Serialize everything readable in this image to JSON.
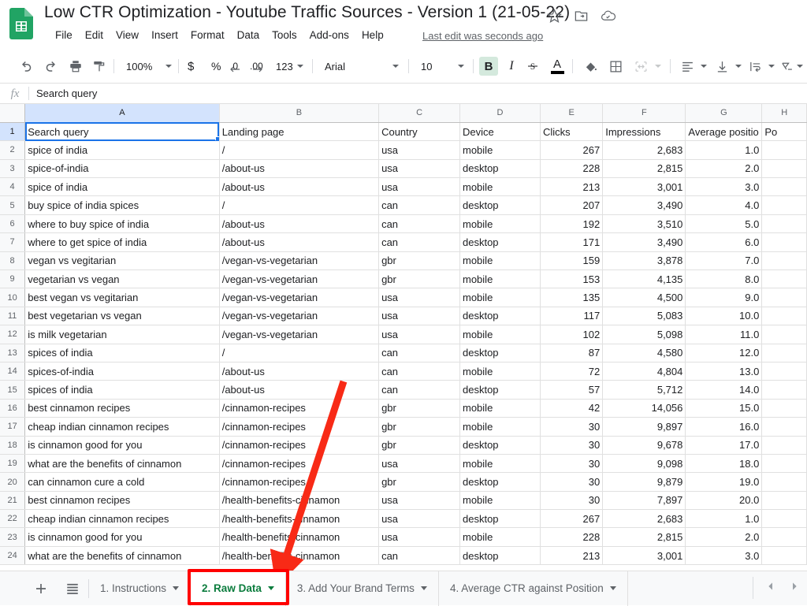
{
  "app": {
    "doc_title": "Low CTR Optimization - Youtube Traffic Sources - Version 1 (21-05-22)",
    "last_edit": "Last edit was seconds ago",
    "icons": {
      "app_logo": "sheets-logo-icon",
      "star": "star-icon",
      "move_to_folder": "move-to-folder-icon",
      "cloud": "cloud-saved-icon"
    }
  },
  "menubar": {
    "items": [
      "File",
      "Edit",
      "View",
      "Insert",
      "Format",
      "Data",
      "Tools",
      "Add-ons",
      "Help"
    ]
  },
  "toolbar": {
    "undo": "undo-icon",
    "redo": "redo-icon",
    "print": "print-icon",
    "paint_format": "paint-format-icon",
    "zoom_value": "100%",
    "currency": "$",
    "percent": "%",
    "decrease_decimal": ".0",
    "increase_decimal": ".00",
    "more_formats": "123",
    "font_name": "Arial",
    "font_size": "10",
    "bold": "B",
    "italic": "I",
    "strikethrough": "S",
    "text_color": "A",
    "fill_color": "fill-color-icon",
    "borders": "borders-icon",
    "merge_cells": "merge-cells-icon",
    "horizontal_align": "horizontal-align-icon",
    "vertical_align": "vertical-align-icon",
    "text_wrap": "text-wrap-icon",
    "text_rotation": "text-rotation-icon"
  },
  "formula_bar": {
    "fx_label": "fx",
    "value": "Search query"
  },
  "grid": {
    "column_letters": [
      "A",
      "B",
      "C",
      "D",
      "E",
      "F",
      "G",
      "H"
    ],
    "selected_cell": "A1",
    "headers": [
      "Search query",
      "Landing page",
      "Country",
      "Device",
      "Clicks",
      "Impressions",
      "Average positio",
      "Po"
    ],
    "rows": [
      {
        "n": "2",
        "a": "spice of india",
        "b": "/",
        "c": "usa",
        "d": "mobile",
        "e": "267",
        "f": "2,683",
        "g": "1.0"
      },
      {
        "n": "3",
        "a": "spice-of-india",
        "b": "/about-us",
        "c": "usa",
        "d": "desktop",
        "e": "228",
        "f": "2,815",
        "g": "2.0"
      },
      {
        "n": "4",
        "a": "spice of india",
        "b": "/about-us",
        "c": "usa",
        "d": "mobile",
        "e": "213",
        "f": "3,001",
        "g": "3.0"
      },
      {
        "n": "5",
        "a": "buy spice of india spices",
        "b": "/",
        "c": "can",
        "d": "desktop",
        "e": "207",
        "f": "3,490",
        "g": "4.0"
      },
      {
        "n": "6",
        "a": "where to buy spice of india",
        "b": "/about-us",
        "c": "can",
        "d": "mobile",
        "e": "192",
        "f": "3,510",
        "g": "5.0"
      },
      {
        "n": "7",
        "a": "where to get spice of india",
        "b": "/about-us",
        "c": "can",
        "d": "desktop",
        "e": "171",
        "f": "3,490",
        "g": "6.0"
      },
      {
        "n": "8",
        "a": "vegan vs vegitarian",
        "b": "/vegan-vs-vegetarian",
        "c": "gbr",
        "d": "mobile",
        "e": "159",
        "f": "3,878",
        "g": "7.0"
      },
      {
        "n": "9",
        "a": "vegetarian vs vegan",
        "b": "/vegan-vs-vegetarian",
        "c": "gbr",
        "d": "mobile",
        "e": "153",
        "f": "4,135",
        "g": "8.0"
      },
      {
        "n": "10",
        "a": "best vegan vs vegitarian",
        "b": "/vegan-vs-vegetarian",
        "c": "usa",
        "d": "mobile",
        "e": "135",
        "f": "4,500",
        "g": "9.0"
      },
      {
        "n": "11",
        "a": "best vegetarian vs vegan",
        "b": "/vegan-vs-vegetarian",
        "c": "usa",
        "d": "desktop",
        "e": "117",
        "f": "5,083",
        "g": "10.0"
      },
      {
        "n": "12",
        "a": "is milk vegetarian",
        "b": "/vegan-vs-vegetarian",
        "c": "usa",
        "d": "mobile",
        "e": "102",
        "f": "5,098",
        "g": "11.0"
      },
      {
        "n": "13",
        "a": "spices of india",
        "b": "/",
        "c": "can",
        "d": "desktop",
        "e": "87",
        "f": "4,580",
        "g": "12.0"
      },
      {
        "n": "14",
        "a": "spices-of-india",
        "b": "/about-us",
        "c": "can",
        "d": "mobile",
        "e": "72",
        "f": "4,804",
        "g": "13.0"
      },
      {
        "n": "15",
        "a": "spices of india",
        "b": "/about-us",
        "c": "can",
        "d": "desktop",
        "e": "57",
        "f": "5,712",
        "g": "14.0"
      },
      {
        "n": "16",
        "a": "best cinnamon recipes",
        "b": "/cinnamon-recipes",
        "c": "gbr",
        "d": "mobile",
        "e": "42",
        "f": "14,056",
        "g": "15.0"
      },
      {
        "n": "17",
        "a": "cheap indian cinnamon recipes",
        "b": "/cinnamon-recipes",
        "c": "gbr",
        "d": "mobile",
        "e": "30",
        "f": "9,897",
        "g": "16.0"
      },
      {
        "n": "18",
        "a": "is cinnamon good for you",
        "b": "/cinnamon-recipes",
        "c": "gbr",
        "d": "desktop",
        "e": "30",
        "f": "9,678",
        "g": "17.0"
      },
      {
        "n": "19",
        "a": "what are the benefits of cinnamon",
        "b": "/cinnamon-recipes",
        "c": "usa",
        "d": "mobile",
        "e": "30",
        "f": "9,098",
        "g": "18.0"
      },
      {
        "n": "20",
        "a": "can cinnamon cure a cold",
        "b": "/cinnamon-recipes",
        "c": "gbr",
        "d": "desktop",
        "e": "30",
        "f": "9,879",
        "g": "19.0"
      },
      {
        "n": "21",
        "a": "best cinnamon recipes",
        "b": "/health-benefits-cinnamon",
        "c": "usa",
        "d": "mobile",
        "e": "30",
        "f": "7,897",
        "g": "20.0"
      },
      {
        "n": "22",
        "a": "cheap indian cinnamon recipes",
        "b": "/health-benefits-cinnamon",
        "c": "usa",
        "d": "desktop",
        "e": "267",
        "f": "2,683",
        "g": "1.0"
      },
      {
        "n": "23",
        "a": "is cinnamon good for you",
        "b": "/health-benefits-cinnamon",
        "c": "usa",
        "d": "mobile",
        "e": "228",
        "f": "2,815",
        "g": "2.0"
      },
      {
        "n": "24",
        "a": "what are the benefits of cinnamon",
        "b": "/health-benefits-cinnamon",
        "c": "can",
        "d": "desktop",
        "e": "213",
        "f": "3,001",
        "g": "3.0"
      }
    ]
  },
  "sheet_tabs": {
    "add_sheet": "add-sheet-icon",
    "all_sheets": "all-sheets-icon",
    "tabs": [
      {
        "label": "1. Instructions",
        "active": false
      },
      {
        "label": "2. Raw Data",
        "active": true
      },
      {
        "label": "3. Add Your Brand Terms",
        "active": false
      },
      {
        "label": "4. Average CTR against Position",
        "active": false
      }
    ],
    "prev_arrow": "prev-sheet-icon",
    "next_arrow": "next-sheet-icon"
  },
  "annotation": {
    "arrow_color": "#f82a16",
    "highlight_color": "#ff0000",
    "points_to": "2. Raw Data"
  }
}
